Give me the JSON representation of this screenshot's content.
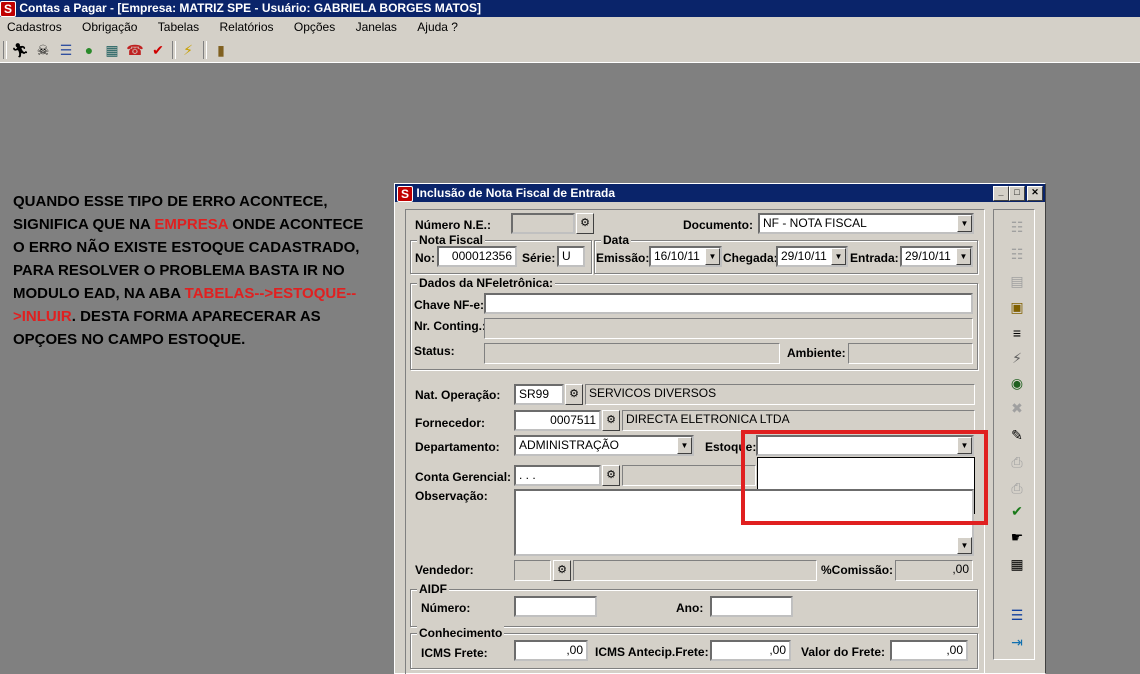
{
  "app": {
    "title": "Contas a Pagar - [Empresa: MATRIZ SPE - Usuário: GABRIELA BORGES MATOS]",
    "logo_letter": "S"
  },
  "menu": [
    "Cadastros",
    "Obrigação",
    "Tabelas",
    "Relatórios",
    "Opções",
    "Janelas",
    "Ajuda ?"
  ],
  "toolbar_icons": [
    "run-icon",
    "bomb-icon",
    "printer-icon",
    "money-bag-icon",
    "calculator-icon",
    "phone-icon",
    "check-icon",
    "lightning-icon",
    "exit-door-icon"
  ],
  "note": {
    "p1": "QUANDO ESSE TIPO DE ERRO ACONTECE, SIGNIFICA QUE NA ",
    "empresa": "EMPRESA",
    "p2": " ONDE ACONTECE O ERRO NÃO EXISTE ESTOQUE CADASTRADO, PARA RESOLVER O PROBLEMA BASTA IR NO MODULO EAD, NA ABA ",
    "path": "TABELAS-->ESTOQUE-->INLUIR",
    "p3": ". DESTA FORMA APARECERAR AS OPÇOES NO CAMPO ESTOQUE."
  },
  "dialog": {
    "title": "Inclusão de Nota Fiscal de Entrada",
    "numero_ne_label": "Número N.E.:",
    "numero_ne_value": "",
    "documento_label": "Documento:",
    "documento_value": "NF - NOTA FISCAL",
    "nota_fiscal_group": "Nota Fiscal",
    "no_label": "No:",
    "no_value": "000012356",
    "serie_label": "Série:",
    "serie_value": "U",
    "data_group": "Data",
    "emissao_label": "Emissão:",
    "emissao_value": "16/10/11",
    "chegada_label": "Chegada:",
    "chegada_value": "29/10/11",
    "entrada_label": "Entrada:",
    "entrada_value": "29/10/11",
    "nfe_group": "Dados da NFeletrônica:",
    "chave_label": "Chave NF-e:",
    "chave_value": "",
    "nr_conting_label": "Nr. Conting.:",
    "status_label": "Status:",
    "ambiente_label": "Ambiente:",
    "nat_op_label": "Nat. Operação:",
    "nat_op_code": "SR99",
    "nat_op_desc": "SERVICOS DIVERSOS",
    "fornecedor_label": "Fornecedor:",
    "fornecedor_code": "0007511",
    "fornecedor_name": "DIRECTA ELETRONICA LTDA",
    "departamento_label": "Departamento:",
    "departamento_value": "ADMINISTRAÇÃO",
    "estoque_label": "Estoque:",
    "estoque_value": "",
    "conta_label": "Conta Gerencial:",
    "conta_value": ". . .",
    "observacao_label": "Observação:",
    "vendedor_label": "Vendedor:",
    "comissao_label": "%Comissão:",
    "comissao_value": ",00",
    "aidf_group": "AIDF",
    "aidf_numero_label": "Número:",
    "aidf_ano_label": "Ano:",
    "conhecimento_group": "Conhecimento",
    "icms_frete_label": "ICMS Frete:",
    "icms_frete_value": ",00",
    "icms_antecip_label": "ICMS Antecip.Frete:",
    "icms_antecip_value": ",00",
    "valor_frete_label": "Valor do Frete:",
    "valor_frete_value": ",00"
  },
  "highlight_color": "#e02020"
}
